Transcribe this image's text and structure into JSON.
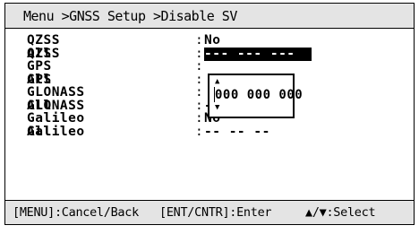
{
  "header": {
    "breadcrumb": "Menu >GNSS Setup >Disable SV"
  },
  "settings": [
    {
      "label": "QZSS All",
      "colon": ":",
      "value": "No"
    },
    {
      "label": "QZSS",
      "colon": ":",
      "value": "--- --- ---",
      "selected": true
    },
    {
      "label": "GPS All",
      "colon": ":",
      "value": ""
    },
    {
      "label": "GPS",
      "colon": ":",
      "value": ""
    },
    {
      "label": "GLONASS All",
      "colon": ":",
      "value": ""
    },
    {
      "label": "GLONASS",
      "colon": ":",
      "value": "-- -- --"
    },
    {
      "label": "Galileo All",
      "colon": ":",
      "value": "No"
    },
    {
      "label": "Galileo",
      "colon": ":",
      "value": "-- -- --"
    }
  ],
  "editor": {
    "up_arrow": "▲",
    "value": "000 000 000",
    "down_arrow": "▼"
  },
  "footer": {
    "cancel": "[MENU]:Cancel/Back",
    "enter": "[ENT/CNTR]:Enter",
    "select": "▲/▼:Select"
  }
}
